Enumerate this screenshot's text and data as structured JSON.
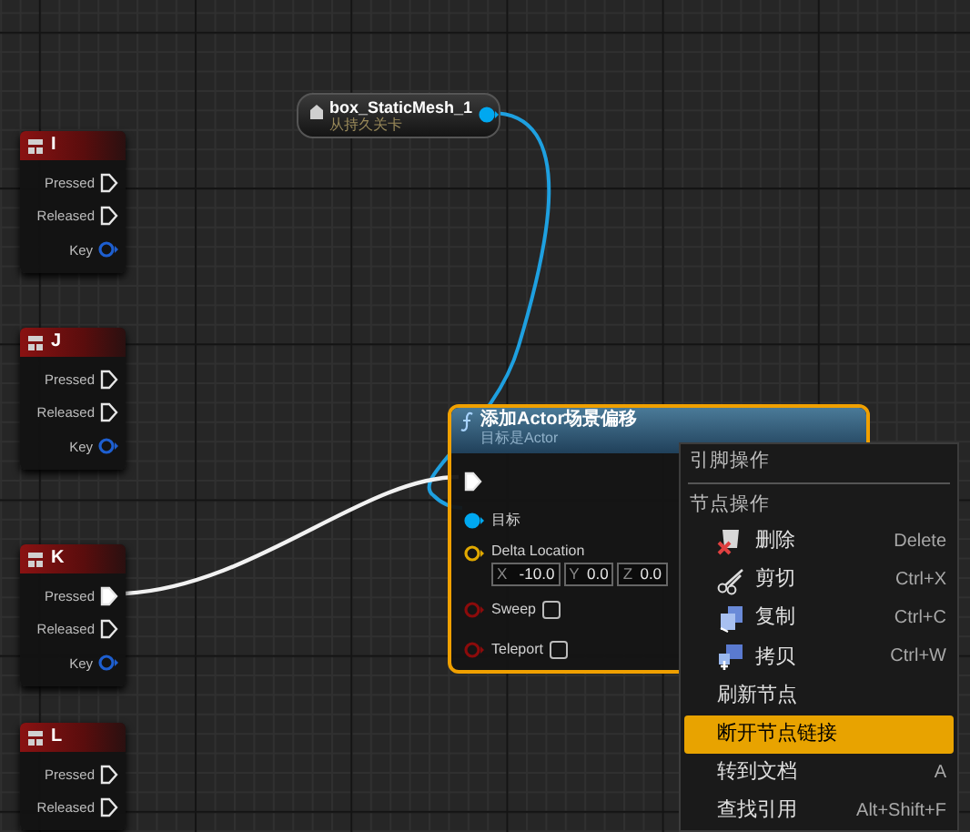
{
  "input_events": [
    {
      "key": "I",
      "pins": [
        {
          "label": "Pressed",
          "kind": "exec",
          "connected": false
        },
        {
          "label": "Released",
          "kind": "exec",
          "connected": false
        },
        {
          "label": "Key",
          "kind": "struct",
          "connected": false
        }
      ]
    },
    {
      "key": "J",
      "pins": [
        {
          "label": "Pressed",
          "kind": "exec",
          "connected": false
        },
        {
          "label": "Released",
          "kind": "exec",
          "connected": false
        },
        {
          "label": "Key",
          "kind": "struct",
          "connected": false
        }
      ]
    },
    {
      "key": "K",
      "pins": [
        {
          "label": "Pressed",
          "kind": "exec",
          "connected": true
        },
        {
          "label": "Released",
          "kind": "exec",
          "connected": false
        },
        {
          "label": "Key",
          "kind": "struct",
          "connected": false
        }
      ]
    },
    {
      "key": "L",
      "pins": [
        {
          "label": "Pressed",
          "kind": "exec",
          "connected": false
        },
        {
          "label": "Released",
          "kind": "exec",
          "connected": false
        }
      ]
    }
  ],
  "variable_node": {
    "name": "box_StaticMesh_1",
    "subtitle": "从持久关卡",
    "connected": true
  },
  "function_node": {
    "title": "添加Actor场景偏移",
    "subtitle": "目标是Actor",
    "selected": true,
    "pins": [
      {
        "kind": "exec",
        "connected": true
      },
      {
        "kind": "object",
        "label": "目标",
        "connected": true
      },
      {
        "kind": "vector",
        "label": "Delta Location",
        "connected": false,
        "fields": [
          {
            "axis": "X",
            "value": "-10.0"
          },
          {
            "axis": "Y",
            "value": "0.0"
          },
          {
            "axis": "Z",
            "value": "0.0"
          }
        ]
      },
      {
        "kind": "bool",
        "label": "Sweep",
        "connected": false,
        "checked": false
      },
      {
        "kind": "bool",
        "label": "Teleport",
        "connected": false,
        "checked": false
      }
    ]
  },
  "context_menu": {
    "items": [
      {
        "kind": "header",
        "label": "引脚操作"
      },
      {
        "kind": "header",
        "label": "节点操作"
      },
      {
        "kind": "action",
        "label": "删除",
        "shortcut": "Delete",
        "selected": false
      },
      {
        "kind": "action",
        "label": "剪切",
        "shortcut": "Ctrl+X",
        "selected": false
      },
      {
        "kind": "action",
        "label": "复制",
        "shortcut": "Ctrl+C",
        "selected": false
      },
      {
        "kind": "action",
        "label": "拷贝",
        "shortcut": "Ctrl+W",
        "selected": false
      },
      {
        "kind": "action",
        "label": "刷新节点",
        "selected": false
      },
      {
        "kind": "action",
        "label": "断开节点链接",
        "selected": true
      },
      {
        "kind": "action",
        "label": "转到文档",
        "shortcut": "A",
        "selected": false
      },
      {
        "kind": "action",
        "label": "查找引用",
        "shortcut": "Alt+Shift+F",
        "selected": false
      }
    ]
  }
}
